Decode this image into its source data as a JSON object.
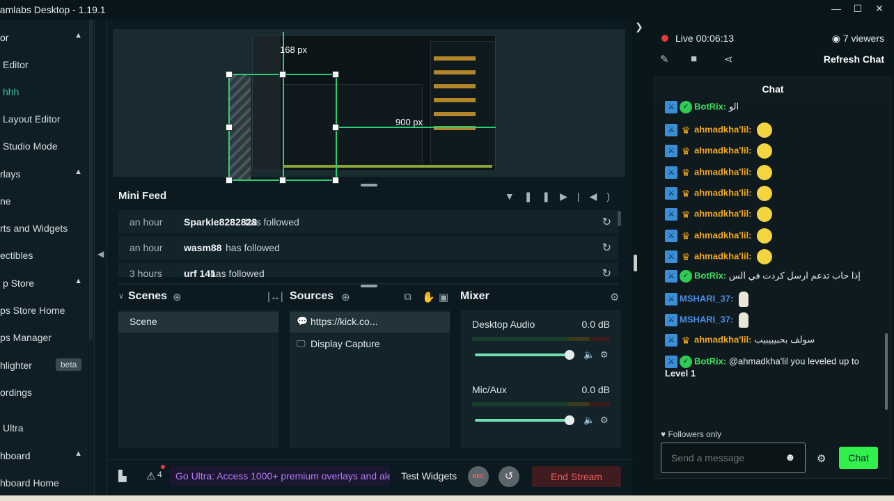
{
  "window": {
    "title": "eamlabs Desktop - 1.19.1",
    "min_glyph": "—",
    "max_glyph": "☐",
    "close_glyph": "✕"
  },
  "sidebar": {
    "items": [
      {
        "label": "or",
        "type": "section",
        "chevron": "▲"
      },
      {
        "label": "Editor"
      },
      {
        "label": "hhh",
        "active": true
      },
      {
        "label": "Layout Editor"
      },
      {
        "label": "Studio Mode"
      },
      {
        "label": "rlays",
        "type": "section",
        "chevron": "▲"
      },
      {
        "label": "ne"
      },
      {
        "label": "rts and Widgets"
      },
      {
        "label": "ectibles"
      },
      {
        "label": "p Store",
        "type": "section",
        "chevron": "▲"
      },
      {
        "label": "ps Store Home"
      },
      {
        "label": "ps Manager"
      },
      {
        "label": "hlighter",
        "badge": "beta"
      },
      {
        "label": "ordings"
      },
      {
        "label": "Ultra"
      },
      {
        "label": "hboard",
        "type": "section",
        "chevron": "▲"
      },
      {
        "label": "hboard Home"
      }
    ]
  },
  "preview": {
    "width_label": "168 px",
    "height_label": "900 px"
  },
  "mini_feed": {
    "title": "Mini Feed",
    "rows": [
      {
        "time": "an hour",
        "user": "Sparkle8282828",
        "action": "has followed"
      },
      {
        "time": "an hour",
        "user": "wasm88",
        "action": "has followed"
      },
      {
        "time": "3 hours",
        "user": "urf 141",
        "action": "has followed"
      }
    ]
  },
  "scenes": {
    "title": "Scenes",
    "items": [
      "Scene"
    ]
  },
  "sources": {
    "title": "Sources",
    "items": [
      {
        "name": "https://kick.co...",
        "icon": "chat-bubble-icon",
        "selected": true
      },
      {
        "name": "Display Capture",
        "icon": "monitor-icon",
        "selected": false
      }
    ]
  },
  "mixer": {
    "title": "Mixer",
    "channels": [
      {
        "name": "Desktop Audio",
        "db": "0.0 dB",
        "volume": 1.0
      },
      {
        "name": "Mic/Aux",
        "db": "0.0 dB",
        "volume": 1.0
      }
    ]
  },
  "footer": {
    "notif_count": "4",
    "promo": "Go Ultra: Access 1000+ premium overlays and aler",
    "test_widgets": "Test Widgets",
    "rec_label": "REC",
    "end_stream": "End Stream"
  },
  "chat": {
    "live": "Live 00:06:13",
    "viewers": "7 viewers",
    "refresh": "Refresh Chat",
    "header": "Chat",
    "messages": [
      {
        "user": "BotRix",
        "kind": "bot",
        "text": "الو"
      },
      {
        "user": "ahmadkha'lil",
        "kind": "sub",
        "text": "",
        "emoji": true
      },
      {
        "user": "ahmadkha'lil",
        "kind": "sub",
        "text": "",
        "emoji": true
      },
      {
        "user": "ahmadkha'lil",
        "kind": "sub",
        "text": "",
        "emoji": true
      },
      {
        "user": "ahmadkha'lil",
        "kind": "sub",
        "text": "",
        "emoji": true
      },
      {
        "user": "ahmadkha'lil",
        "kind": "sub",
        "text": "",
        "emoji": true
      },
      {
        "user": "ahmadkha'lil",
        "kind": "sub",
        "text": "",
        "emoji": true
      },
      {
        "user": "ahmadkha'lil",
        "kind": "sub",
        "text": "",
        "emoji": true
      },
      {
        "user": "BotRix",
        "kind": "bot",
        "text": "إذا حاب تدعم ارسل كردت في الس"
      },
      {
        "user": "MSHARI_37",
        "kind": "mod",
        "text": "",
        "goose": true
      },
      {
        "user": "MSHARI_37",
        "kind": "mod",
        "text": "",
        "goose": true
      },
      {
        "user": "ahmadkha'lil",
        "kind": "sub",
        "text": "سولف بحبيبيبيب"
      },
      {
        "user": "BotRix",
        "kind": "bot",
        "text": "@ahmadkha'lil you leveled up to",
        "text2": "Level 1"
      }
    ],
    "followers_only": "Followers only",
    "input_placeholder": "Send a message",
    "send_label": "Chat"
  }
}
